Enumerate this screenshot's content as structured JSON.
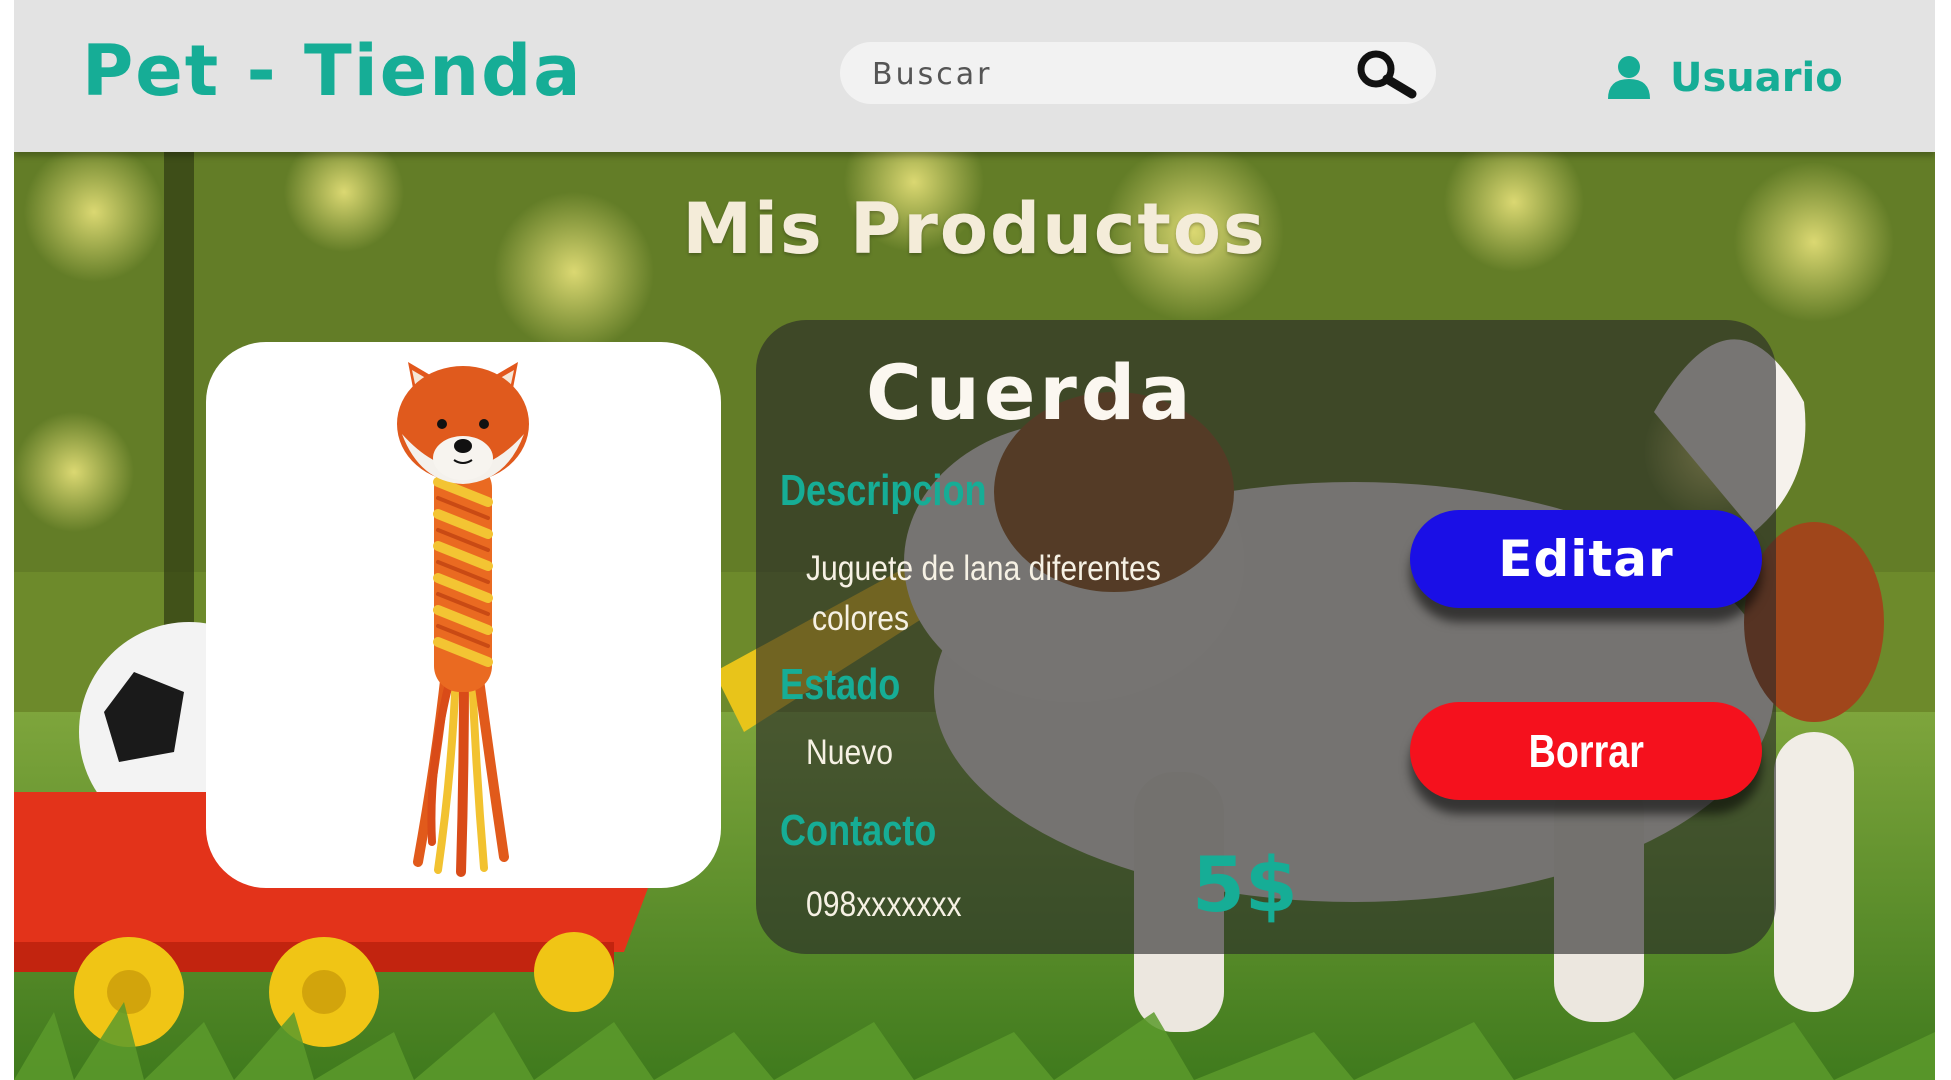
{
  "header": {
    "logo": "Pet - Tienda",
    "search_placeholder": "Buscar",
    "user_label": "Usuario"
  },
  "page": {
    "title": "Mis Productos"
  },
  "product": {
    "name": "Cuerda",
    "description_label": "Descripcion",
    "description_lines": [
      "Juguete de lana diferentes",
      "colores"
    ],
    "status_label": "Estado",
    "status": "Nuevo",
    "contact_label": "Contacto",
    "contact": "098xxxxxxx",
    "price": "5$"
  },
  "actions": {
    "edit": "Editar",
    "delete": "Borrar"
  },
  "colors": {
    "brand": "#16ad96",
    "edit_button": "#1a0fe6",
    "delete_button": "#f5111d",
    "header_bg": "#e3e3e3"
  },
  "icons": {
    "search": "search-icon",
    "user": "user-icon",
    "product_image": "fox-rope-toy"
  }
}
